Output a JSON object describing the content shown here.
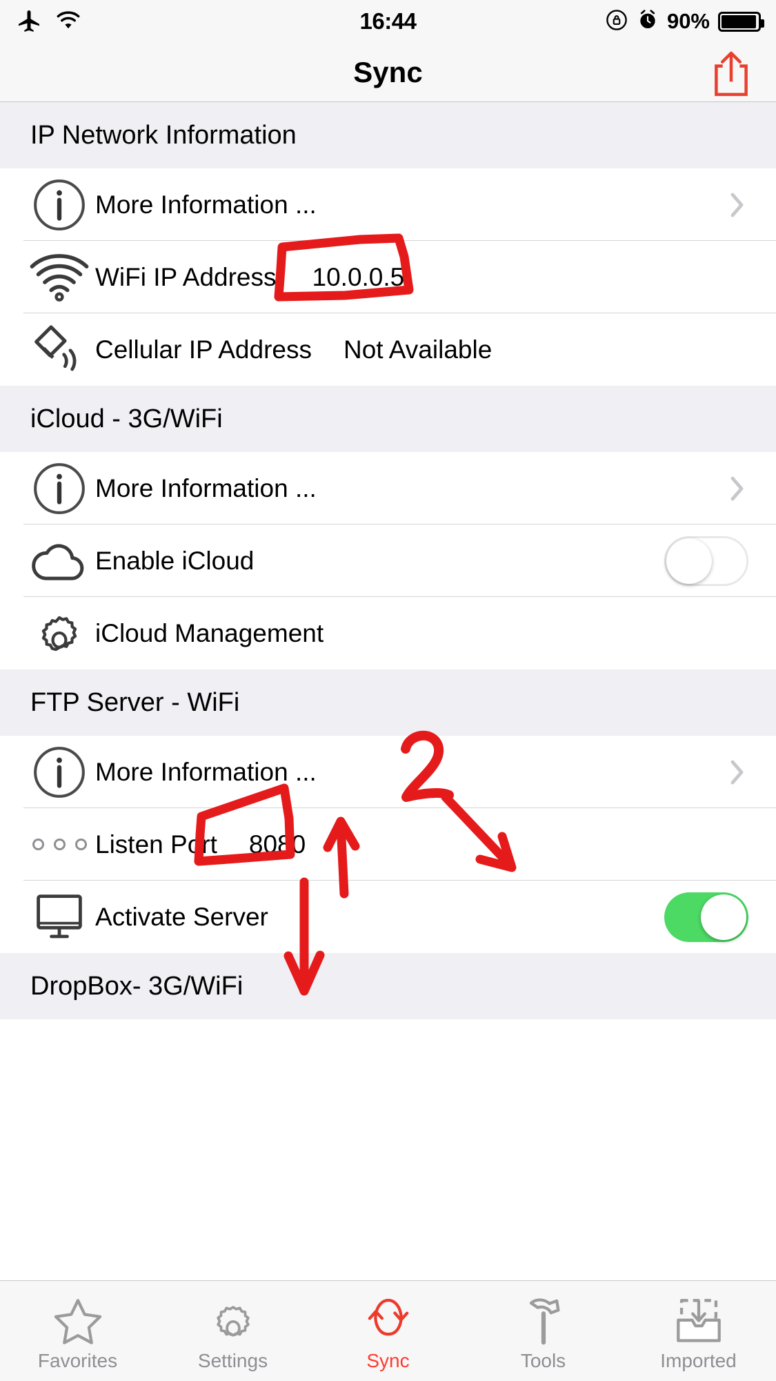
{
  "status_bar": {
    "airplane_icon": "airplane-icon",
    "wifi_icon": "wifi-icon",
    "time": "16:44",
    "rotation_lock_icon": "rotation-lock-icon",
    "alarm_icon": "alarm-icon",
    "battery_percent": "90%",
    "battery_icon": "battery-icon"
  },
  "nav": {
    "title": "Sync",
    "share_icon": "share-icon"
  },
  "sections": [
    {
      "header": "IP Network Information",
      "rows": [
        {
          "icon": "info-circle-icon",
          "label": "More Information ...",
          "value": "",
          "accessory": "chevron"
        },
        {
          "icon": "wifi-icon",
          "label": "WiFi IP Address",
          "value": "10.0.0.5",
          "accessory": "none"
        },
        {
          "icon": "cellular-antenna-icon",
          "label": "Cellular IP Address",
          "value": "Not Available",
          "accessory": "none"
        }
      ]
    },
    {
      "header": "iCloud - 3G/WiFi",
      "rows": [
        {
          "icon": "info-circle-icon",
          "label": "More Information ...",
          "value": "",
          "accessory": "chevron"
        },
        {
          "icon": "cloud-icon",
          "label": "Enable iCloud",
          "value": "",
          "accessory": "toggle-off"
        },
        {
          "icon": "gear-icon",
          "label": "iCloud Management",
          "value": "",
          "accessory": "none"
        }
      ]
    },
    {
      "header": "FTP Server - WiFi",
      "rows": [
        {
          "icon": "info-circle-icon",
          "label": "More Information ...",
          "value": "",
          "accessory": "chevron"
        },
        {
          "icon": "three-dots-icon",
          "label": "Listen Port",
          "value": "8080",
          "accessory": "none"
        },
        {
          "icon": "monitor-icon",
          "label": "Activate Server",
          "value": "",
          "accessory": "toggle-on"
        }
      ]
    },
    {
      "header": "DropBox- 3G/WiFi",
      "rows": []
    }
  ],
  "tabs": [
    {
      "icon": "star-icon",
      "label": "Favorites",
      "active": false
    },
    {
      "icon": "gear-icon",
      "label": "Settings",
      "active": false
    },
    {
      "icon": "sync-icon",
      "label": "Sync",
      "active": true
    },
    {
      "icon": "hammer-icon",
      "label": "Tools",
      "active": false
    },
    {
      "icon": "inbox-download-icon",
      "label": "Imported",
      "active": false
    }
  ],
  "annotations": {
    "color": "#e51b1b",
    "items": [
      {
        "name": "box-around-wifi-ip-value",
        "shape": "rectangle",
        "target": "10.0.0.5"
      },
      {
        "name": "box-around-listen-port-value",
        "shape": "rectangle",
        "target": "8080"
      },
      {
        "name": "arrow-1-up",
        "shape": "arrow",
        "label": ""
      },
      {
        "name": "digit-2-label",
        "shape": "text",
        "label": "2"
      },
      {
        "name": "arrow-2-down-right",
        "shape": "arrow",
        "label": ""
      },
      {
        "name": "arrow-down-to-sync-tab",
        "shape": "arrow",
        "label": ""
      }
    ]
  },
  "colors": {
    "accent_red": "#ff3b30",
    "toggle_on_green": "#4cd964",
    "section_header_bg": "#efeff4",
    "chrome_bg": "#f7f7f7",
    "separator": "#d4d4d6"
  }
}
